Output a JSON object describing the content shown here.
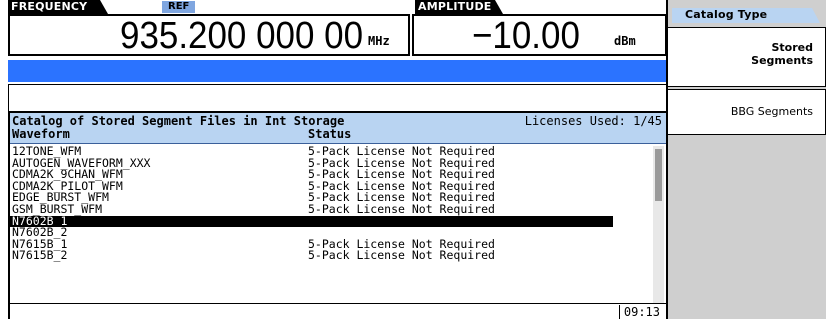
{
  "frequency": {
    "tab_label": "FREQUENCY",
    "ref_badge": "REF",
    "value": "935.200 000 00",
    "unit": "MHz"
  },
  "amplitude": {
    "tab_label": "AMPLITUDE",
    "value": "−10.00",
    "unit": "dBm"
  },
  "catalog": {
    "title": "Catalog of Stored Segment Files in Int Storage",
    "licenses_used": "Licenses Used: 1/45",
    "columns": [
      "Waveform",
      "Status"
    ],
    "rows": [
      {
        "name": "12TONE_WFM",
        "status": "5-Pack License Not Required"
      },
      {
        "name": "AUTOGEN_WAVEFORM_XXX",
        "status": "5-Pack License Not Required"
      },
      {
        "name": "CDMA2K_9CHAN_WFM",
        "status": "5-Pack License Not Required"
      },
      {
        "name": "CDMA2K_PILOT_WFM",
        "status": "5-Pack License Not Required"
      },
      {
        "name": "EDGE_BURST_WFM",
        "status": "5-Pack License Not Required"
      },
      {
        "name": "GSM_BURST_WFM",
        "status": "5-Pack License Not Required"
      },
      {
        "name": "N7602B_1",
        "status": "",
        "selected": true
      },
      {
        "name": "N7602B_2",
        "status": ""
      },
      {
        "name": "N7615B_1",
        "status": "5-Pack License Not Required"
      },
      {
        "name": "N7615B_2",
        "status": "5-Pack License Not Required"
      }
    ],
    "time": "09:13"
  },
  "softkeys": {
    "menu_title": "Catalog Type",
    "stored_segments_line1": "Stored",
    "stored_segments_line2": "Segments",
    "bbg_segments": "BBG Segments"
  },
  "colors": {
    "accent_blue": "#2b73ff",
    "header_band": "#b9d4f2",
    "ref_badge": "#7fa6e0",
    "softkey_panel": "#cfcfcf"
  }
}
